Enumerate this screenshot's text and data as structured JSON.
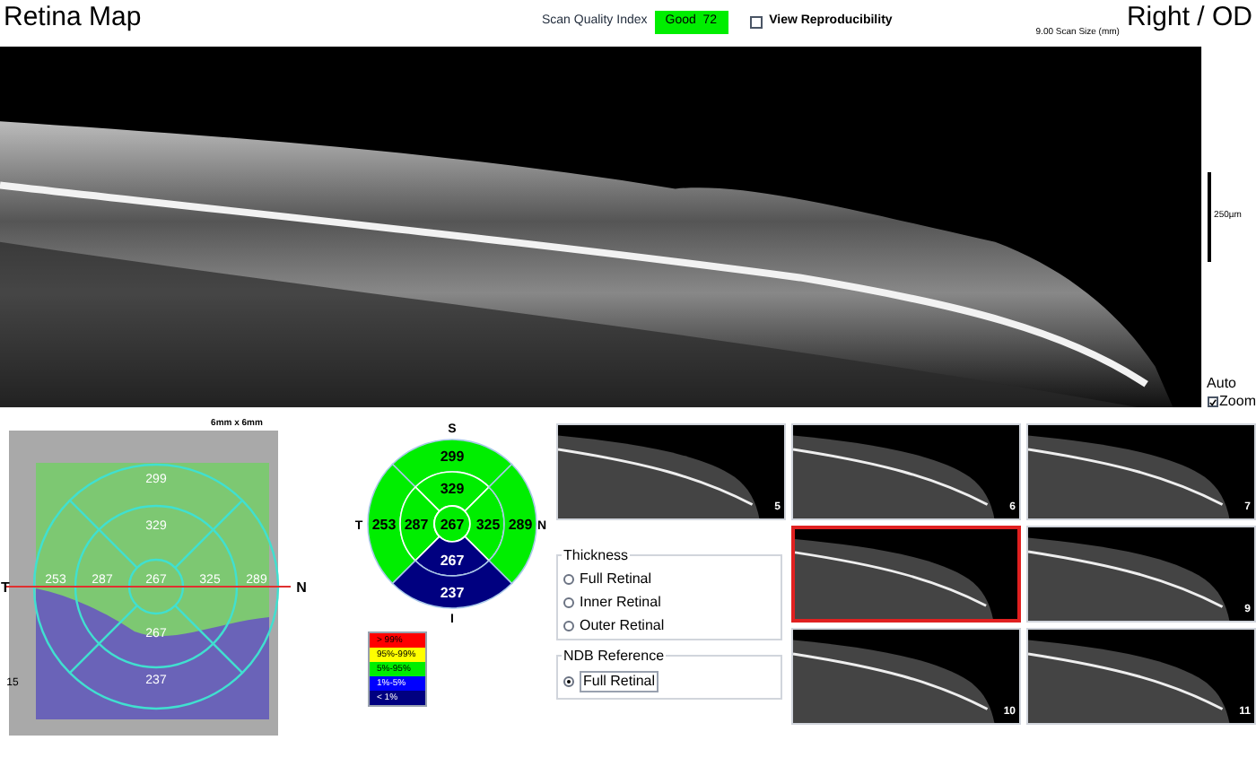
{
  "header": {
    "title": "Retina Map",
    "quality_label": "Scan Quality Index",
    "quality_value": "Good  72",
    "reproducibility": {
      "label": "View Reproducibility",
      "checked": false
    },
    "scan_size": "9.00 Scan Size (mm)",
    "eye": "Right / OD"
  },
  "bscan": {
    "scale_label": "250µm",
    "auto_label": "Auto",
    "zoom": {
      "label": "Zoom",
      "checked": true
    }
  },
  "fundus_map": {
    "size_label": "6mm x 6mm",
    "temporal_label": "T",
    "nasal_label": "N",
    "axis_tick": "15",
    "sectors": [
      {
        "value": "299"
      },
      {
        "value": "329"
      },
      {
        "value": "253"
      },
      {
        "value": "287"
      },
      {
        "value": "267"
      },
      {
        "value": "325"
      },
      {
        "value": "289"
      },
      {
        "value": "267"
      },
      {
        "value": "237"
      }
    ]
  },
  "sector_chart": {
    "superior_label": "S",
    "temporal_label": "T",
    "nasal_label": "N",
    "inferior_label": "I",
    "sectors": [
      {
        "value": "299",
        "color": "#00ee00"
      },
      {
        "value": "329",
        "color": "#00ee00"
      },
      {
        "value": "253",
        "color": "#00ee00"
      },
      {
        "value": "287",
        "color": "#00ee00"
      },
      {
        "value": "267",
        "color": "#00ee00"
      },
      {
        "value": "325",
        "color": "#00ee00"
      },
      {
        "value": "289",
        "color": "#00ee00"
      },
      {
        "value": "267",
        "color": "#000080"
      },
      {
        "value": "237",
        "color": "#000080"
      }
    ]
  },
  "legend": [
    {
      "label": "> 99%",
      "color": "#ff0000"
    },
    {
      "label": "95%-99%",
      "color": "#ffff00"
    },
    {
      "label": "5%-95%",
      "color": "#00ee00"
    },
    {
      "label": "1%-5%",
      "color": "#0000ff"
    },
    {
      "label": "< 1%",
      "color": "#000080"
    }
  ],
  "thumbnails": [
    {
      "number": "5",
      "selected": false
    },
    {
      "number": "6",
      "selected": false
    },
    {
      "number": "7",
      "selected": false
    },
    {
      "selected": true
    },
    {
      "number": "9",
      "selected": false
    },
    {
      "number": "10",
      "selected": false
    },
    {
      "number": "11",
      "selected": false
    }
  ],
  "thickness": {
    "title": "Thickness",
    "options": [
      {
        "label": "Full Retinal",
        "selected": false
      },
      {
        "label": "Inner Retinal",
        "selected": false
      },
      {
        "label": "Outer Retinal",
        "selected": false
      }
    ]
  },
  "ndb_reference": {
    "title": "NDB Reference",
    "options": [
      {
        "label": "Full Retinal",
        "selected": true
      }
    ]
  }
}
